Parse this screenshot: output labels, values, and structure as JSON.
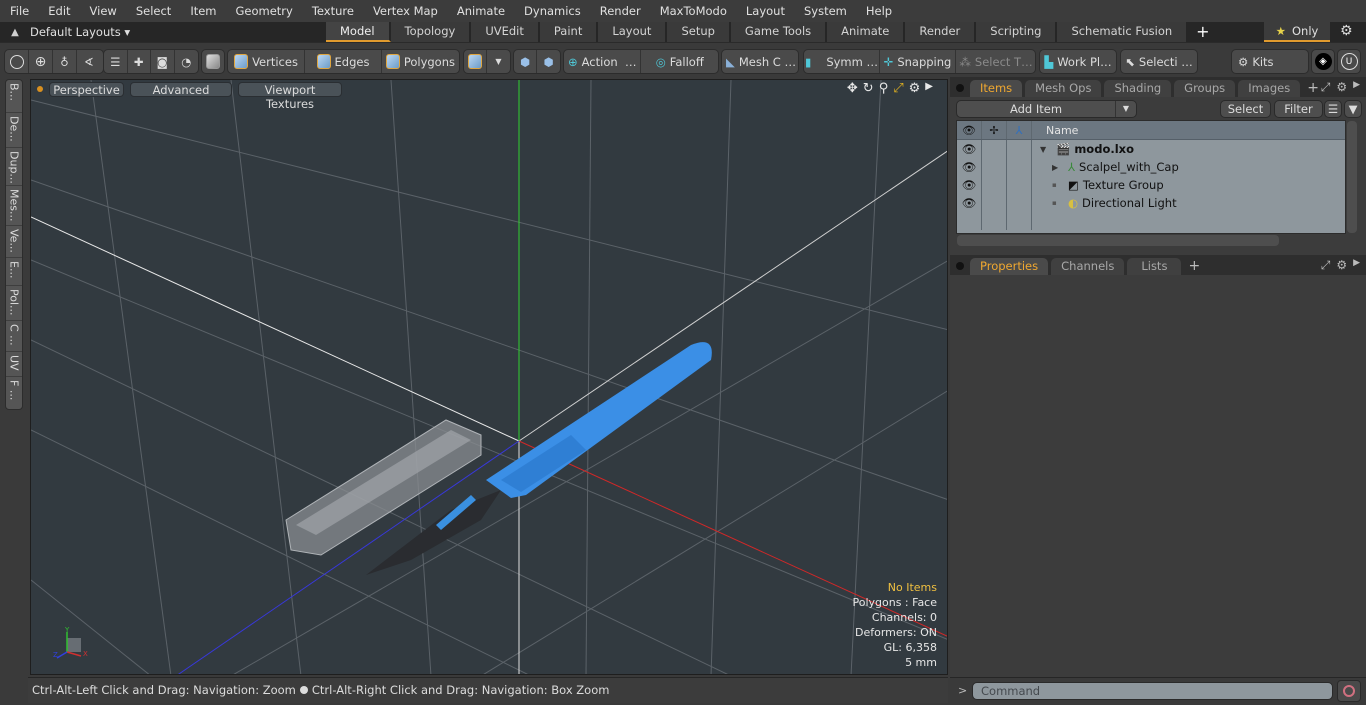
{
  "menu": [
    "File",
    "Edit",
    "View",
    "Select",
    "Item",
    "Geometry",
    "Texture",
    "Vertex Map",
    "Animate",
    "Dynamics",
    "Render",
    "MaxToModo",
    "Layout",
    "System",
    "Help"
  ],
  "layouts": {
    "label": "Default Layouts",
    "arrow": "▾"
  },
  "layout_tabs": [
    {
      "label": "Model",
      "active": true
    },
    {
      "label": "Topology"
    },
    {
      "label": "UVEdit"
    },
    {
      "label": "Paint"
    },
    {
      "label": "Layout"
    },
    {
      "label": "Setup"
    },
    {
      "label": "Game Tools"
    },
    {
      "label": "Animate"
    },
    {
      "label": "Render"
    },
    {
      "label": "Scripting"
    },
    {
      "label": "Schematic Fusion"
    }
  ],
  "layout_tabs_add": "+",
  "only_label": "Only",
  "toolbar": {
    "vertices": "Vertices",
    "edges": "Edges",
    "polygons": "Polygons",
    "action": "Action",
    "falloff": "Falloff",
    "mesh_c": "Mesh C …",
    "symm": "Symm …",
    "snapping": "Snapping",
    "select_t": "Select T…",
    "work_pl": "Work Pl…",
    "selecti": "Selecti …",
    "kits": "Kits",
    "ellipsis": "…"
  },
  "side_tabs": [
    "B...",
    "De...",
    "Dup...",
    "Mes...",
    "Ve...",
    "E...",
    "Pol...",
    "C ...",
    "UV",
    "F ..."
  ],
  "viewport": {
    "buttons": [
      "Perspective",
      "Advanced",
      "Viewport Textures"
    ],
    "info": {
      "selection": "No Items",
      "polygons": "Polygons : Face",
      "channels": "Channels: 0",
      "deformers": "Deformers: ON",
      "gl": "GL: 6,358",
      "unit": "5 mm"
    },
    "axis_labels": {
      "x": "X",
      "y": "Y",
      "z": "Z"
    }
  },
  "status": {
    "left": "Ctrl-Alt-Left Click and Drag: Navigation: Zoom",
    "right": "Ctrl-Alt-Right Click and Drag: Navigation: Box Zoom"
  },
  "items_panel": {
    "tabs": [
      {
        "label": "Items",
        "active": true
      },
      {
        "label": "Mesh Ops"
      },
      {
        "label": "Shading"
      },
      {
        "label": "Groups"
      },
      {
        "label": "Images"
      }
    ],
    "add_tab": "+",
    "add_item": "Add Item",
    "select": "Select",
    "filter": "Filter",
    "column_name": "Name",
    "tree": [
      {
        "name": "modo.lxo",
        "level": 0,
        "bold": true,
        "icon": "clapper-icon",
        "expander": "▼"
      },
      {
        "name": "Scalpel_with_Cap",
        "level": 1,
        "icon": "mesh-locator-icon",
        "expander": "▶"
      },
      {
        "name": "Texture Group",
        "level": 1,
        "icon": "texture-group-icon",
        "expander": "▪"
      },
      {
        "name": "Directional Light",
        "level": 1,
        "icon": "light-icon",
        "expander": "▪"
      }
    ]
  },
  "props_panel": {
    "tabs": [
      {
        "label": "Properties",
        "active": true
      },
      {
        "label": "Channels"
      },
      {
        "label": "Lists"
      }
    ],
    "add_tab": "+"
  },
  "command": {
    "prompt": ">",
    "placeholder": "Command"
  }
}
